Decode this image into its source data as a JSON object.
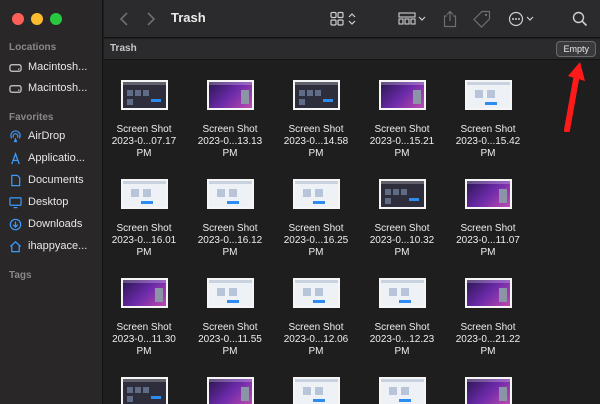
{
  "window": {
    "title": "Trash",
    "path_label": "Trash",
    "empty_label": "Empty"
  },
  "sidebar": {
    "sections": {
      "locations": "Locations",
      "favorites": "Favorites",
      "tags": "Tags"
    },
    "locations": [
      {
        "label": "Macintosh...",
        "icon": "drive-icon"
      },
      {
        "label": "Macintosh...",
        "icon": "drive-icon"
      }
    ],
    "favorites": [
      {
        "label": "AirDrop",
        "icon": "airdrop-icon"
      },
      {
        "label": "Applicatio...",
        "icon": "applications-icon"
      },
      {
        "label": "Documents",
        "icon": "document-icon"
      },
      {
        "label": "Desktop",
        "icon": "desktop-icon"
      },
      {
        "label": "Downloads",
        "icon": "download-icon"
      },
      {
        "label": "ihappyace...",
        "icon": "home-icon"
      }
    ]
  },
  "files": [
    {
      "name": "Screen Shot",
      "date": "2023-0...07.17 PM",
      "style": "dark"
    },
    {
      "name": "Screen Shot",
      "date": "2023-0...13.13 PM",
      "style": "purple"
    },
    {
      "name": "Screen Shot",
      "date": "2023-0...14.58 PM",
      "style": "dark"
    },
    {
      "name": "Screen Shot",
      "date": "2023-0...15.21 PM",
      "style": "purple"
    },
    {
      "name": "Screen Shot",
      "date": "2023-0...15.42 PM",
      "style": "light"
    },
    {
      "name": "Screen Shot",
      "date": "2023-0...16.01 PM",
      "style": "light"
    },
    {
      "name": "Screen Shot",
      "date": "2023-0...16.12 PM",
      "style": "light"
    },
    {
      "name": "Screen Shot",
      "date": "2023-0...16.25 PM",
      "style": "light"
    },
    {
      "name": "Screen Shot",
      "date": "2023-0...10.32 PM",
      "style": "dark"
    },
    {
      "name": "Screen Shot",
      "date": "2023-0...11.07 PM",
      "style": "purple"
    },
    {
      "name": "Screen Shot",
      "date": "2023-0...11.30 PM",
      "style": "purple"
    },
    {
      "name": "Screen Shot",
      "date": "2023-0...11.55 PM",
      "style": "light"
    },
    {
      "name": "Screen Shot",
      "date": "2023-0...12.06 PM",
      "style": "light"
    },
    {
      "name": "Screen Shot",
      "date": "2023-0...12.23 PM",
      "style": "light"
    },
    {
      "name": "Screen Shot",
      "date": "2023-0...21.22 PM",
      "style": "purple"
    },
    {
      "name": "",
      "date": "",
      "style": "dark"
    },
    {
      "name": "",
      "date": "",
      "style": "purple"
    },
    {
      "name": "",
      "date": "",
      "style": "light"
    },
    {
      "name": "",
      "date": "",
      "style": "light"
    },
    {
      "name": "",
      "date": "",
      "style": "purple"
    }
  ],
  "colors": {
    "accent": "#2d8cf0",
    "annotation": "#ff1a1a",
    "close": "#fe5f57",
    "minimize": "#febc2e",
    "maximize": "#28c840"
  }
}
